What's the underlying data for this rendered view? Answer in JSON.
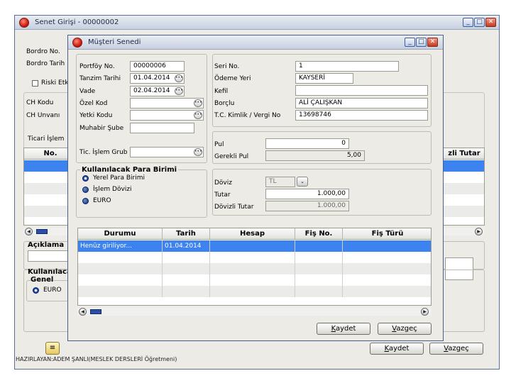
{
  "back_window": {
    "title": "Senet Girişi - 00000002",
    "labels": {
      "bordro_no": "Bordro No.",
      "bordro_tarihi": "Bordro Tarih",
      "riski_etkile": "Riski Etk",
      "ch_kodu": "CH Kodu",
      "ch_unvani": "CH Unvanı",
      "ticari_islem": "Ticari İşlem",
      "grid_no": "No.",
      "grid_dovizli_tutar": "zli Tutar",
      "aciklama": "Açıklama",
      "kullanilacak": "Kullanılaca",
      "genel": "Genel",
      "euro": "EURO"
    },
    "buttons": {
      "ok": "Kaydet",
      "ok_key": "K",
      "cancel": "Vazgeç",
      "cancel_key": "V"
    }
  },
  "dialog": {
    "title": "Müşteri Senedi",
    "left": {
      "portfoy_label": "Portföy No.",
      "portfoy_value": "00000006",
      "tanzim_label": "Tanzim Tarihi",
      "tanzim_value": "01.04.2014",
      "vade_label": "Vade",
      "vade_value": "02.04.2014",
      "ozel_kod_label": "Özel Kod",
      "yetki_kodu_label": "Yetki Kodu",
      "muhabir_label": "Muhabir Şube",
      "tic_islem_label": "Tic. İşlem Grub"
    },
    "para_birimi": {
      "legend": "Kullanılacak Para Birimi",
      "options": [
        "Yerel Para Birimi",
        "İşlem Dövizi",
        "EURO"
      ],
      "selected_index": 0
    },
    "right": {
      "seri_label": "Seri No.",
      "seri_value": "1",
      "odeme_label": "Ödeme Yeri",
      "odeme_value": "KAYSERİ",
      "kefil_label": "Kefil",
      "kefil_value": "",
      "borclu_label": "Borçlu",
      "borclu_value": "ALİ ÇALIŞKAN",
      "tc_label": "T.C. Kimlik / Vergi No",
      "tc_value": "13698746"
    },
    "pul": {
      "pul_label": "Pul",
      "pul_value": "0",
      "gerekli_label": "Gerekli Pul",
      "gerekli_value": "5,00"
    },
    "doviz": {
      "doviz_label": "Döviz",
      "doviz_value": "TL",
      "tutar_label": "Tutar",
      "tutar_value": "1.000,00",
      "dovizli_label": "Dövizli Tutar",
      "dovizli_value": "1.000,00"
    },
    "grid": {
      "columns": [
        "Durumu",
        "Tarih",
        "Hesap",
        "Fiş No.",
        "Fiş Türü"
      ],
      "rows": [
        {
          "durumu": "Henüz giriliyor...",
          "tarih": "01.04.2014",
          "hesap": "",
          "fis_no": "",
          "fis_turu": ""
        }
      ]
    },
    "buttons": {
      "ok": "Kaydet",
      "ok_key": "K",
      "cancel": "Vazgeç",
      "cancel_key": "V"
    }
  },
  "footer": {
    "credit": "HAZIRLAYAN:ADEM ŞANLI(MESLEK DERSLERİ Öğretmeni)"
  },
  "colors": {
    "selection": "#3d83f0",
    "window_bg": "#ecebe6",
    "title_gradient_end": "#c7d0df"
  }
}
